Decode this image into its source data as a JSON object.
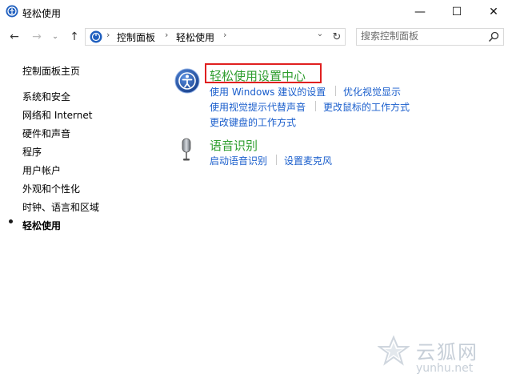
{
  "window": {
    "title": "轻松使用",
    "minimize_label": "—",
    "maximize_label": "☐",
    "close_label": "✕"
  },
  "nav": {
    "back": "←",
    "forward": "→",
    "recent": "⌄",
    "up": "↑",
    "address_dropdown": "⌄",
    "refresh": "↻"
  },
  "breadcrumbs": [
    {
      "label": "控制面板"
    },
    {
      "label": "轻松使用"
    }
  ],
  "breadcrumb_separator": "›",
  "search": {
    "placeholder": "搜索控制面板"
  },
  "sidebar": {
    "home": "控制面板主页",
    "items": [
      {
        "label": "系统和安全"
      },
      {
        "label": "网络和 Internet"
      },
      {
        "label": "硬件和声音"
      },
      {
        "label": "程序"
      },
      {
        "label": "用户帐户"
      },
      {
        "label": "外观和个性化"
      },
      {
        "label": "时钟、语言和区域"
      },
      {
        "label": "轻松使用",
        "current": true
      }
    ]
  },
  "sections": [
    {
      "title": "轻松使用设置中心",
      "icon": "ease-of-access-icon",
      "links": [
        [
          "使用 Windows 建议的设置",
          "优化视觉显示"
        ],
        [
          "使用视觉提示代替声音",
          "更改鼠标的工作方式"
        ],
        [
          "更改键盘的工作方式"
        ]
      ]
    },
    {
      "title": "语音识别",
      "icon": "microphone-icon",
      "links": [
        [
          "启动语音识别",
          "设置麦克风"
        ]
      ]
    }
  ],
  "watermark": {
    "text": "云狐网",
    "url": "yunhu.net"
  },
  "colors": {
    "section_title": "#2f9e2f",
    "link": "#1a5ecc",
    "highlight_box": "#e02020",
    "watermark": "#c7cfd8"
  }
}
